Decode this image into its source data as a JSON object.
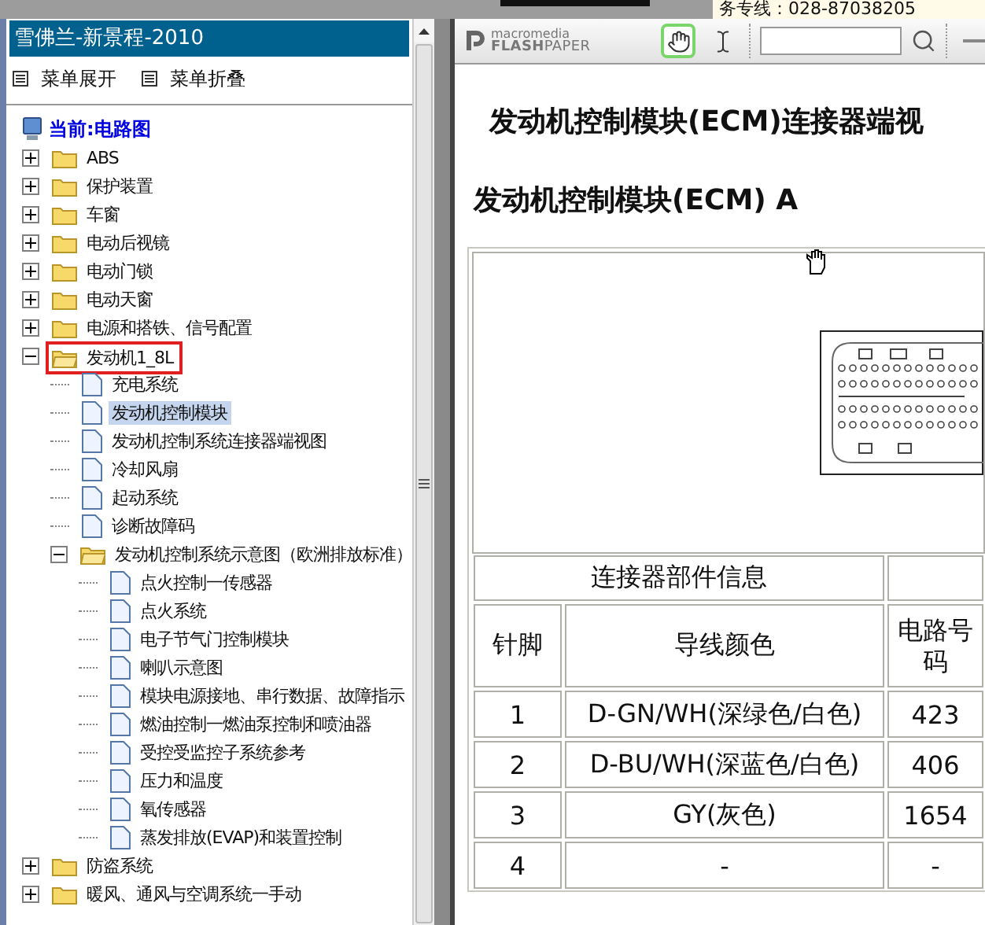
{
  "top_banner": {
    "hotline": "务专线：028-87038205"
  },
  "sidebar": {
    "title": "雪佛兰-新景程-2010",
    "menu": [
      {
        "label": "菜单展开"
      },
      {
        "label": "菜单折叠"
      }
    ],
    "tree_root": {
      "label": "当前:电路图"
    },
    "tree": [
      {
        "kind": "folder",
        "label": "ABS",
        "expanded": false,
        "selected": false,
        "outlined": false
      },
      {
        "kind": "folder",
        "label": "保护装置",
        "expanded": false,
        "selected": false,
        "outlined": false
      },
      {
        "kind": "folder",
        "label": "车窗",
        "expanded": false,
        "selected": false,
        "outlined": false
      },
      {
        "kind": "folder",
        "label": "电动后视镜",
        "expanded": false,
        "selected": false,
        "outlined": false
      },
      {
        "kind": "folder",
        "label": "电动门锁",
        "expanded": false,
        "selected": false,
        "outlined": false
      },
      {
        "kind": "folder",
        "label": "电动天窗",
        "expanded": false,
        "selected": false,
        "outlined": false
      },
      {
        "kind": "folder",
        "label": "电源和搭铁、信号配置",
        "expanded": false,
        "selected": false,
        "outlined": false
      },
      {
        "kind": "folder",
        "label": "发动机1_8L",
        "expanded": true,
        "selected": false,
        "outlined": true,
        "children": [
          {
            "kind": "page",
            "label": "充电系统",
            "selected": false,
            "outlined": false
          },
          {
            "kind": "page",
            "label": "发动机控制模块",
            "selected": true,
            "outlined": false
          },
          {
            "kind": "page",
            "label": "发动机控制系统连接器端视图",
            "selected": false,
            "outlined": false
          },
          {
            "kind": "page",
            "label": "冷却风扇",
            "selected": false,
            "outlined": false
          },
          {
            "kind": "page",
            "label": "起动系统",
            "selected": false,
            "outlined": false
          },
          {
            "kind": "page",
            "label": "诊断故障码",
            "selected": false,
            "outlined": false
          },
          {
            "kind": "folder",
            "label": "发动机控制系统示意图（欧洲排放标准）",
            "expanded": true,
            "selected": false,
            "outlined": false,
            "children": [
              {
                "kind": "page",
                "label": "点火控制一传感器",
                "selected": false,
                "outlined": false
              },
              {
                "kind": "page",
                "label": "点火系统",
                "selected": false,
                "outlined": false
              },
              {
                "kind": "page",
                "label": "电子节气门控制模块",
                "selected": false,
                "outlined": false
              },
              {
                "kind": "page",
                "label": "喇叭示意图",
                "selected": false,
                "outlined": false
              },
              {
                "kind": "page",
                "label": "模块电源接地、串行数据、故障指示",
                "selected": false,
                "outlined": false
              },
              {
                "kind": "page",
                "label": "燃油控制一燃油泵控制和喷油器",
                "selected": false,
                "outlined": false
              },
              {
                "kind": "page",
                "label": "受控受监控子系统参考",
                "selected": false,
                "outlined": false
              },
              {
                "kind": "page",
                "label": "压力和温度",
                "selected": false,
                "outlined": false
              },
              {
                "kind": "page",
                "label": "氧传感器",
                "selected": false,
                "outlined": false
              },
              {
                "kind": "page",
                "label": "蒸发排放(EVAP)和装置控制",
                "selected": false,
                "outlined": false
              }
            ]
          }
        ]
      },
      {
        "kind": "folder",
        "label": "防盗系统",
        "expanded": false,
        "selected": false,
        "outlined": false
      },
      {
        "kind": "folder",
        "label": "暖风、通风与空调系统一手动",
        "expanded": false,
        "selected": false,
        "outlined": false
      }
    ]
  },
  "viewer": {
    "toolbar": {
      "logo_top": "macromedia",
      "logo_bottom": "**FLASH**PAPER",
      "tools": [
        {
          "kind": "hand",
          "selected": true
        },
        {
          "kind": "text-select",
          "selected": false
        }
      ]
    },
    "document": {
      "heading": "发动机控制模块(ECM)连接器端视",
      "subheading": "发动机控制模块(ECM) A",
      "table": {
        "group_header": "连接器部件信息",
        "columns": [
          "针脚",
          "导线颜色",
          "电路号码"
        ],
        "rows": [
          [
            "1",
            "D-GN/WH(深绿色/白色)",
            "423"
          ],
          [
            "2",
            "D-BU/WH(深蓝色/白色)",
            "406"
          ],
          [
            "3",
            "GY(灰色)",
            "1654"
          ],
          [
            "4",
            "-",
            "-"
          ]
        ]
      }
    }
  }
}
